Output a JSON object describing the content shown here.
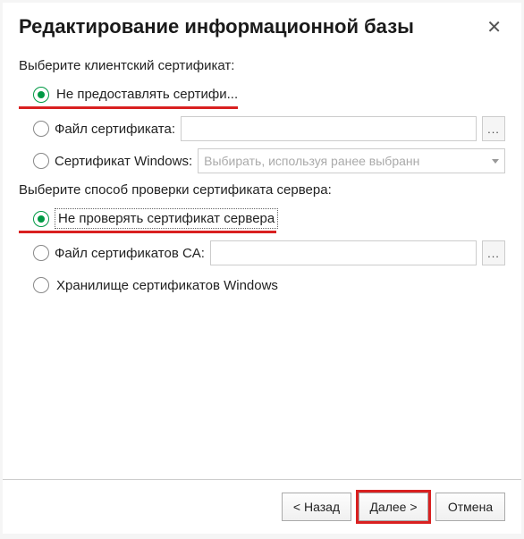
{
  "dialog": {
    "title": "Редактирование информационной базы",
    "close": "✕"
  },
  "client_cert": {
    "group_label": "Выберите клиентский сертификат:",
    "opt_none": "Не предоставлять сертифи...",
    "opt_file": "Файл сертификата:",
    "opt_windows": "Сертификат Windows:",
    "file_value": "",
    "browse_label": "...",
    "windows_dropdown": "Выбирать, используя ранее выбранн"
  },
  "server_cert": {
    "group_label": "Выберите способ проверки сертификата сервера:",
    "opt_none": "Не проверять сертификат сервера",
    "opt_ca_file": "Файл сертификатов CA:",
    "opt_windows_store": "Хранилище сертификатов Windows",
    "ca_file_value": "",
    "browse_label": "..."
  },
  "footer": {
    "back": "< Назад",
    "next": "Далее >",
    "cancel": "Отмена"
  }
}
